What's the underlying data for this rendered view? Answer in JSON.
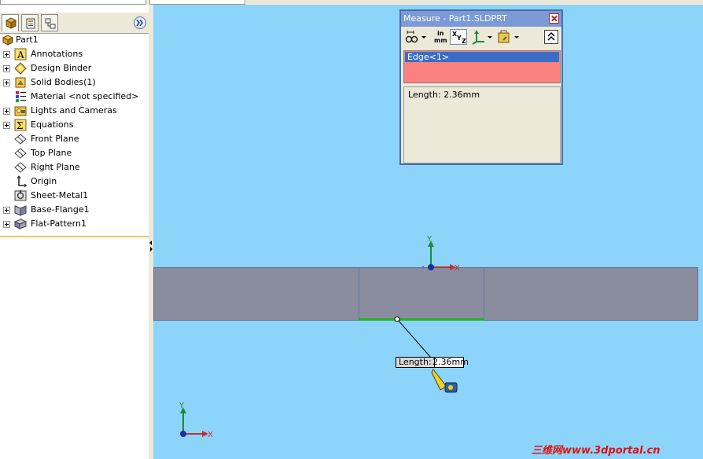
{
  "feature_tree": {
    "root": "Part1",
    "items": [
      {
        "label": "Annotations",
        "icon": "annotations-icon",
        "expandable": true
      },
      {
        "label": "Design Binder",
        "icon": "design-binder-icon",
        "expandable": true
      },
      {
        "label": "Solid Bodies(1)",
        "icon": "solid-bodies-icon",
        "expandable": true
      },
      {
        "label": "Material <not specified>",
        "icon": "material-icon",
        "expandable": false
      },
      {
        "label": "Lights and Cameras",
        "icon": "lights-cameras-icon",
        "expandable": true
      },
      {
        "label": "Equations",
        "icon": "equations-icon",
        "expandable": true
      },
      {
        "label": "Front Plane",
        "icon": "plane-icon",
        "expandable": false
      },
      {
        "label": "Top Plane",
        "icon": "plane-icon",
        "expandable": false
      },
      {
        "label": "Right Plane",
        "icon": "plane-icon",
        "expandable": false
      },
      {
        "label": "Origin",
        "icon": "origin-icon",
        "expandable": false
      },
      {
        "label": "Sheet-Metal1",
        "icon": "sheet-metal-icon",
        "expandable": false
      },
      {
        "label": "Base-Flange1",
        "icon": "base-flange-icon",
        "expandable": true
      },
      {
        "label": "Flat-Pattern1",
        "icon": "flat-pattern-icon",
        "expandable": true
      }
    ]
  },
  "measure": {
    "title": "Measure - Part1.SLDPRT",
    "units_label_top": "in",
    "units_label_bottom": "mm",
    "selection": "Edge<1>",
    "result": "Length: 2.36mm"
  },
  "callout": {
    "key": "Length:",
    "value": "2.36mm"
  },
  "axes": {
    "x": "X",
    "y": "Y"
  },
  "watermark": "三维网www.3dportal.cn",
  "colors": {
    "viewport": "#8cd4fa",
    "part": "#8a8da0",
    "selected_edge": "#22b222",
    "selection_box": "#fb8080",
    "dialog_title": "#7b9ad6"
  }
}
